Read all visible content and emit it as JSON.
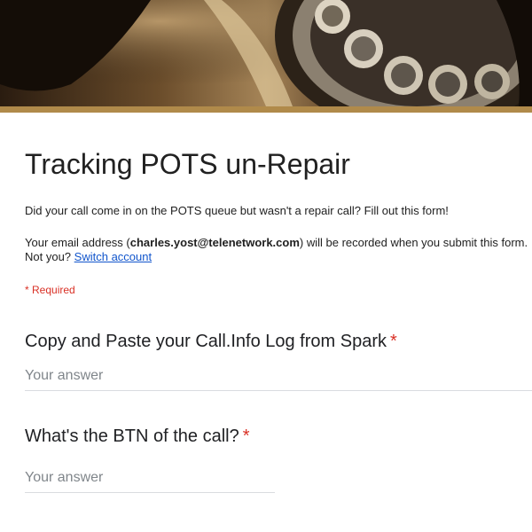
{
  "form": {
    "title": "Tracking POTS un-Repair",
    "description": "Did your call come in on the POTS queue but wasn't a repair call? Fill out this form!",
    "email_prefix": "Your email address (",
    "email": "charles.yost@telenetwork.com",
    "email_suffix": ") will be recorded when you submit this form.",
    "not_you": "Not you?",
    "switch_account": "Switch account",
    "required_note": "* Required"
  },
  "questions": [
    {
      "title": "Copy and Paste your Call.Info Log from Spark",
      "required_mark": "*",
      "placeholder": "Your answer"
    },
    {
      "title": "What's the BTN of the call?",
      "required_mark": "*",
      "placeholder": "Your answer"
    }
  ],
  "theme": {
    "accent": "#b08a4a",
    "required": "#d93025",
    "link": "#1155cc"
  },
  "header": {
    "image": "vintage-rotary-phone-photo"
  }
}
